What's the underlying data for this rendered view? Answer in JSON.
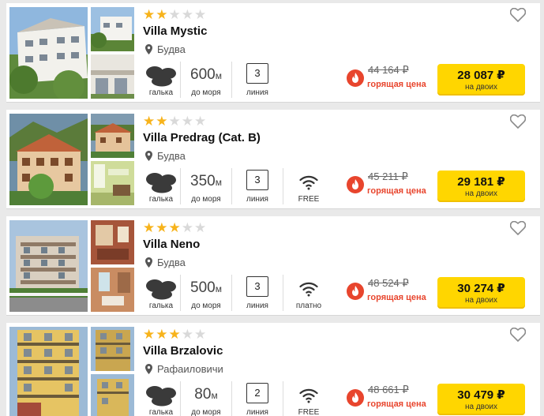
{
  "colors": {
    "star": "#f7b31b",
    "hot": "#e8452d",
    "button": "#ffd600"
  },
  "hotels": [
    {
      "name": "Villa Mystic",
      "stars": 2,
      "location": "Будва",
      "beach_label": "галька",
      "sea_value": "600",
      "sea_unit": "м",
      "sea_label": "до моря",
      "line_value": "3",
      "line_label": "линия",
      "wifi_label": "",
      "old_price": "44 164 ₽",
      "hot_label": "горящая цена",
      "price": "28 087 ₽",
      "price_note": "на двоих"
    },
    {
      "name": "Villa Predrag (Cat. B)",
      "stars": 2,
      "location": "Будва",
      "beach_label": "галька",
      "sea_value": "350",
      "sea_unit": "м",
      "sea_label": "до моря",
      "line_value": "3",
      "line_label": "линия",
      "wifi_label": "FREE",
      "old_price": "45 211 ₽",
      "hot_label": "горящая цена",
      "price": "29 181 ₽",
      "price_note": "на двоих"
    },
    {
      "name": "Villa Neno",
      "stars": 3,
      "location": "Будва",
      "beach_label": "галька",
      "sea_value": "500",
      "sea_unit": "м",
      "sea_label": "до моря",
      "line_value": "3",
      "line_label": "линия",
      "wifi_label": "платно",
      "old_price": "48 524 ₽",
      "hot_label": "горящая цена",
      "price": "30 274 ₽",
      "price_note": "на двоих"
    },
    {
      "name": "Villa Brzalovic",
      "stars": 3,
      "location": "Рафаиловичи",
      "beach_label": "галька",
      "sea_value": "80",
      "sea_unit": "м",
      "sea_label": "до моря",
      "line_value": "2",
      "line_label": "линия",
      "wifi_label": "FREE",
      "old_price": "48 661 ₽",
      "hot_label": "горящая цена",
      "price": "30 479 ₽",
      "price_note": "на двоих"
    }
  ]
}
